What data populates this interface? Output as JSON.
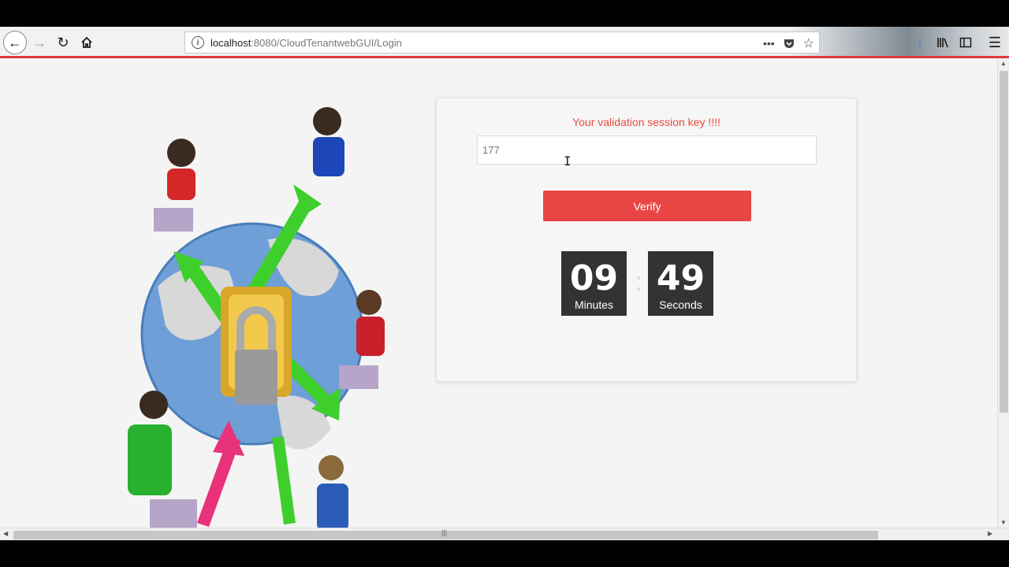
{
  "browser": {
    "url_host": "localhost",
    "url_rest": ":8080/CloudTenantwebGUI/Login",
    "icons": [
      "back-arrow-icon",
      "forward-arrow-icon",
      "reload-icon",
      "home-icon",
      "info-icon",
      "more-icon",
      "pocket-icon",
      "star-icon",
      "download-icon",
      "library-icon",
      "sidebar-icon",
      "menu-icon"
    ]
  },
  "card": {
    "title": "Your validation session key !!!!",
    "key_value": "177",
    "verify_label": "Verify",
    "timer": {
      "minutes": "09",
      "minutes_label": "Minutes",
      "seconds": "49",
      "seconds_label": "Seconds"
    }
  },
  "colors": {
    "accent": "#e94545",
    "title": "#e74c3c",
    "timer_bg": "#333333"
  }
}
